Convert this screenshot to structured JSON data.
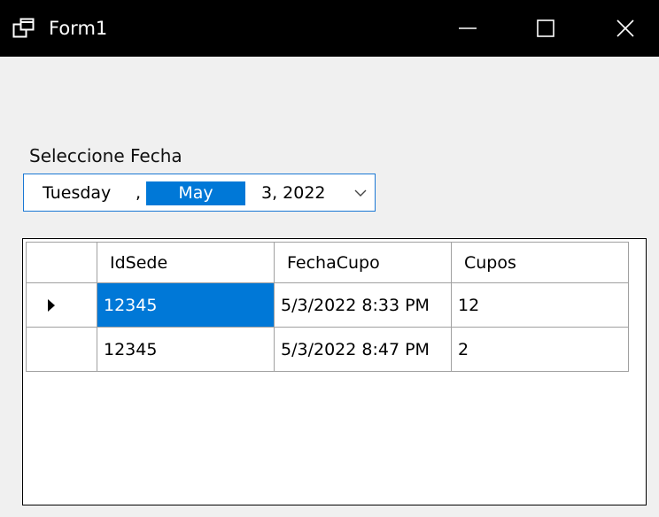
{
  "window": {
    "title": "Form1",
    "icon": "form-window-icon",
    "controls": [
      "minimize-icon",
      "maximize-icon",
      "close-icon"
    ]
  },
  "label": {
    "text": "Seleccione Fecha"
  },
  "date_picker": {
    "weekday": "Tuesday",
    "separator": ",",
    "month": "May",
    "day_year": "3, 2022",
    "dropdown_icon": "chevron-down-icon",
    "accent": "#0078d7"
  },
  "grid": {
    "columns": [
      "IdSede",
      "FechaCupo",
      "Cupos"
    ],
    "rows": [
      {
        "idsede": "12345",
        "fechacupo": "5/3/2022 8:33 PM",
        "cupos": "12",
        "current": true,
        "selected": true
      },
      {
        "idsede": "12345",
        "fechacupo": "5/3/2022 8:47 PM",
        "cupos": "2",
        "current": false,
        "selected": false
      }
    ],
    "row_pointer_icon": "row-pointer-icon",
    "selection_color": "#0078d7"
  }
}
